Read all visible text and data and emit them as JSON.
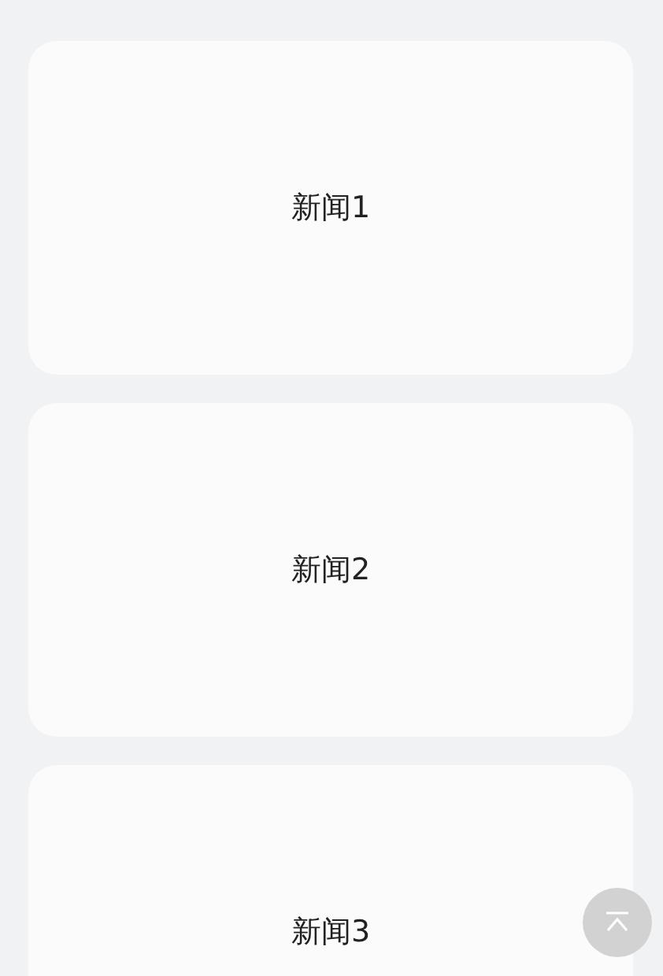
{
  "news_cards": [
    {
      "title": "新闻1"
    },
    {
      "title": "新闻2"
    },
    {
      "title": "新闻3"
    }
  ]
}
